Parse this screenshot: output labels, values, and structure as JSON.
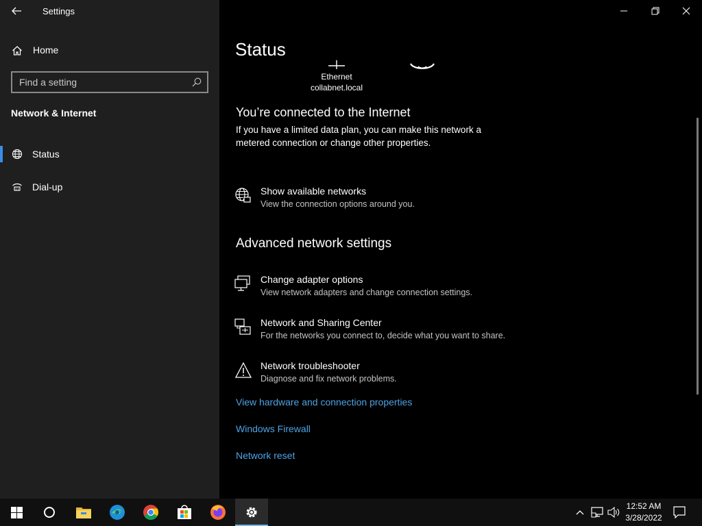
{
  "window": {
    "title": "Settings"
  },
  "sidebar": {
    "home_label": "Home",
    "search_placeholder": "Find a setting",
    "section_title": "Network & Internet",
    "items": [
      {
        "label": "Status",
        "icon": "globe-network-icon",
        "selected": true
      },
      {
        "label": "Dial-up",
        "icon": "dialup-phone-icon",
        "selected": false
      }
    ]
  },
  "main": {
    "page_title": "Status",
    "network": {
      "name": "Ethernet",
      "domain": "collabnet.local"
    },
    "connected_heading": "You’re connected to the Internet",
    "connected_text": "If you have a limited data plan, you can make this network a metered connection or change other properties.",
    "show_networks": {
      "title": "Show available networks",
      "desc": "View the connection options around you."
    },
    "advanced_heading": "Advanced network settings",
    "options": [
      {
        "title": "Change adapter options",
        "desc": "View network adapters and change connection settings.",
        "icon": "adapter-icon"
      },
      {
        "title": "Network and Sharing Center",
        "desc": "For the networks you connect to, decide what you want to share.",
        "icon": "sharing-center-icon"
      },
      {
        "title": "Network troubleshooter",
        "desc": "Diagnose and fix network problems.",
        "icon": "warning-icon"
      }
    ],
    "links": [
      "View hardware and connection properties",
      "Windows Firewall",
      "Network reset"
    ]
  },
  "taskbar": {
    "apps": [
      "start-icon",
      "cortana-icon",
      "file-explorer-icon",
      "edge-icon",
      "chrome-icon",
      "store-icon",
      "firefox-icon",
      "settings-icon"
    ],
    "clock": {
      "time": "12:52 AM",
      "date": "3/28/2022"
    }
  },
  "colors": {
    "accent": "#3a8ee6",
    "link": "#4da3e6",
    "sidebar_bg": "#1f1f1f",
    "main_bg": "#000000"
  }
}
